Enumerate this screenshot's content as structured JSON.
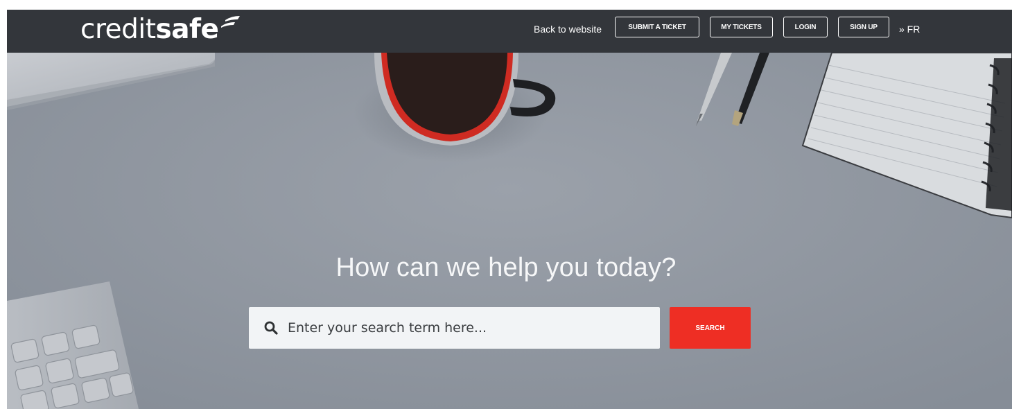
{
  "header": {
    "logo": {
      "part_a": "credit",
      "part_b": "safe"
    },
    "nav": {
      "back_to_website": "Back to website",
      "submit_ticket": "SUBMIT A TICKET",
      "my_tickets": "MY TICKETS",
      "login": "LOGIN",
      "sign_up": "SIGN UP",
      "language": "» FR"
    }
  },
  "hero": {
    "headline": "How can we help you today?",
    "search": {
      "placeholder": "Enter your search term here...",
      "value": "",
      "button_label": "SEARCH",
      "icon": "search-icon"
    }
  },
  "colors": {
    "header_bg": "#33363b",
    "hero_bg": "#8d949e",
    "accent": "#ee2e24",
    "text_light": "#ffffff"
  },
  "icons": {
    "logo_mark": "creditsafe-swoosh-icon",
    "search": "search-icon"
  }
}
